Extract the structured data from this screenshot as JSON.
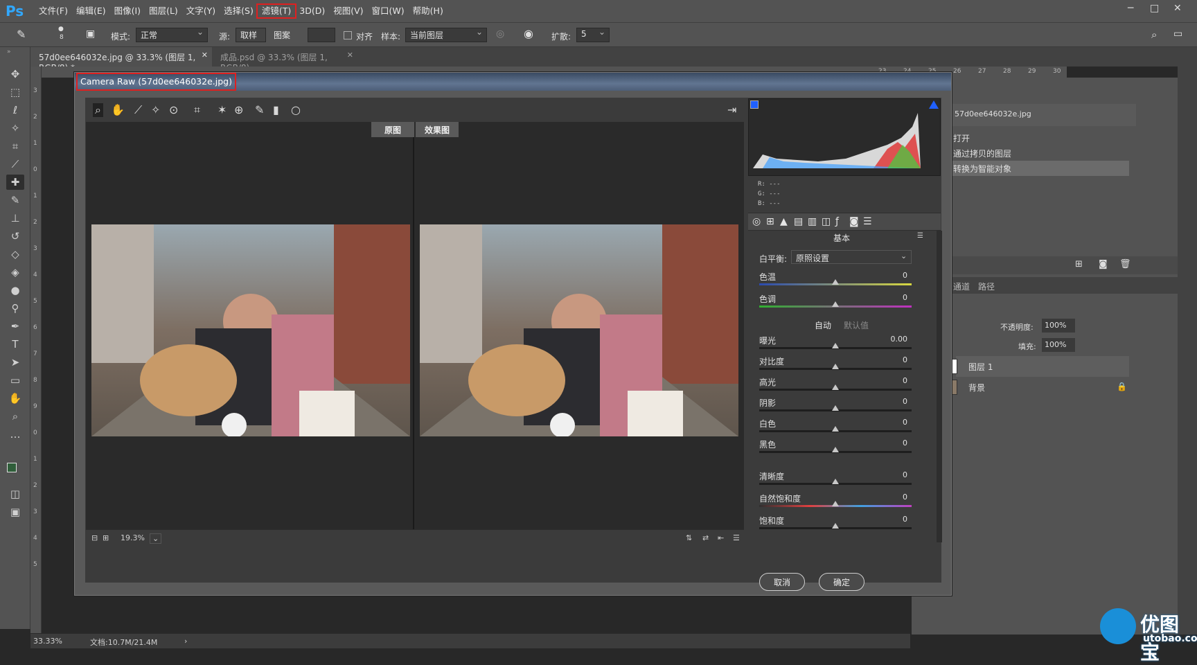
{
  "app": {
    "logo": "Ps"
  },
  "menu": [
    "文件(F)",
    "编辑(E)",
    "图像(I)",
    "图层(L)",
    "文字(Y)",
    "选择(S)",
    "滤镜(T)",
    "3D(D)",
    "视图(V)",
    "窗口(W)",
    "帮助(H)"
  ],
  "options": {
    "brush_size": "8",
    "mode_label": "模式:",
    "mode_value": "正常",
    "source_label": "源:",
    "sampled": "取样",
    "pattern": "图案",
    "aligned": "对齐",
    "sample_label": "样本:",
    "sample_value": "当前图层",
    "diffusion_label": "扩散:",
    "diffusion_value": "5"
  },
  "tabs": [
    {
      "label": "57d0ee646032e.jpg @ 33.3% (图层 1, RGB/8) *"
    },
    {
      "label": "成品.psd @ 33.3% (图层 1, RGB/8)"
    }
  ],
  "ruler": {
    "h": [
      "23",
      "24",
      "25",
      "26",
      "27",
      "28",
      "29",
      "30"
    ],
    "v": [
      "3",
      "2",
      "1",
      "0",
      "1",
      "2",
      "3",
      "4",
      "5",
      "6",
      "7",
      "8",
      "9",
      "0",
      "1",
      "2",
      "3",
      "4",
      "5"
    ]
  },
  "dialog": {
    "title": "Camera Raw (57d0ee646032e.jpg)",
    "before_label": "原图",
    "after_label": "效果图",
    "zoom": "19.3%",
    "rgb": {
      "r": "R:  ---",
      "g": "G:  ---",
      "b": "B:  ---"
    },
    "panel_title": "基本",
    "white_balance_label": "白平衡:",
    "white_balance_value": "原照设置",
    "auto": "自动",
    "default": "默认值",
    "sliders": [
      {
        "label": "色温",
        "value": "0"
      },
      {
        "label": "色调",
        "value": "0"
      },
      {
        "label": "曝光",
        "value": "0.00"
      },
      {
        "label": "对比度",
        "value": "0"
      },
      {
        "label": "高光",
        "value": "0"
      },
      {
        "label": "阴影",
        "value": "0"
      },
      {
        "label": "白色",
        "value": "0"
      },
      {
        "label": "黑色",
        "value": "0"
      },
      {
        "label": "清晰度",
        "value": "0"
      },
      {
        "label": "自然饱和度",
        "value": "0"
      },
      {
        "label": "饱和度",
        "value": "0"
      }
    ],
    "cancel": "取消",
    "ok": "确定"
  },
  "history": {
    "snapshot": "57d0ee646032e.jpg",
    "items": [
      "打开",
      "通过拷贝的图层",
      "转换为智能对象"
    ]
  },
  "layers_panel": {
    "tabs": [
      "通道",
      "路径"
    ],
    "opacity_label": "不透明度:",
    "opacity_value": "100%",
    "fill_label": "填充:",
    "fill_value": "100%",
    "layers": [
      "图层 1",
      "背景"
    ]
  },
  "status": {
    "zoom": "33.33%",
    "doc": "文档:10.7M/21.4M"
  },
  "watermark": {
    "text": "优图宝",
    "url": "utobao.com"
  },
  "colors": {
    "accent": "#31a8ff",
    "highlight_box": "#e02020"
  }
}
